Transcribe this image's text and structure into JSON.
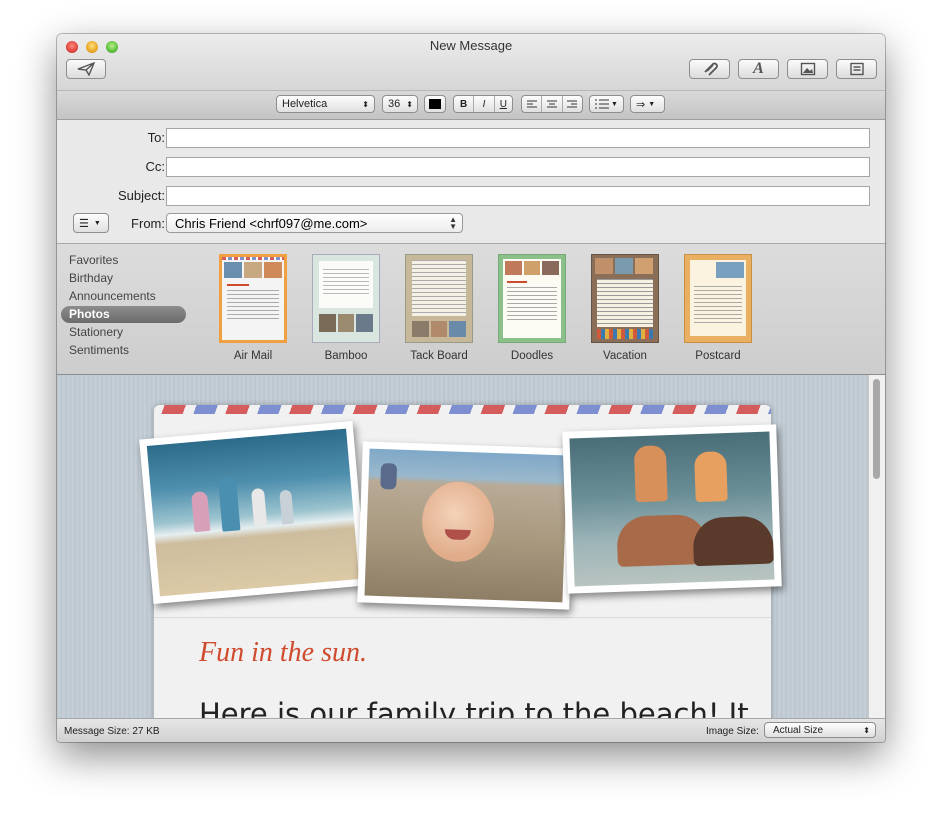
{
  "window": {
    "title": "New Message"
  },
  "toolbar": {
    "send_icon": "paper-plane-icon",
    "buttons": [
      "paperclip-icon",
      "fonts-icon",
      "photo-browser-icon",
      "stationery-icon"
    ]
  },
  "format_bar": {
    "font_family": "Helvetica",
    "font_size": "36",
    "bold": "B",
    "italic": "I",
    "underline": "U",
    "text_color": "#000000"
  },
  "headers": {
    "to_label": "To:",
    "cc_label": "Cc:",
    "subject_label": "Subject:",
    "from_label": "From:",
    "to_value": "",
    "cc_value": "",
    "subject_value": "",
    "from_value": "Chris Friend <chrf097@me.com>",
    "header_menu_icon": "list-icon"
  },
  "stationery": {
    "categories": [
      "Favorites",
      "Birthday",
      "Announcements",
      "Photos",
      "Stationery",
      "Sentiments"
    ],
    "selected_category": "Photos",
    "templates": [
      "Air Mail",
      "Bamboo",
      "Tack Board",
      "Doodles",
      "Vacation",
      "Postcard"
    ],
    "selected_template": "Air Mail"
  },
  "message": {
    "headline": "Fun in the sun.",
    "body": "Here is our family trip to the beach! It"
  },
  "status": {
    "message_size": "Message Size: 27 KB",
    "image_size_label": "Image Size:",
    "image_size_value": "Actual Size"
  },
  "colors": {
    "headline": "#d04a2e",
    "airmail_red": "#d45c5c",
    "airmail_blue": "#7d8fd0",
    "selection": "#f0a040"
  }
}
